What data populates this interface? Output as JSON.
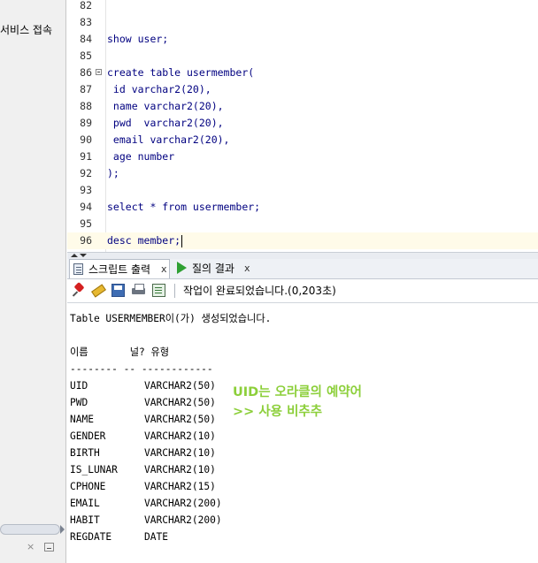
{
  "connections_panel": {
    "label": "서비스 접속"
  },
  "editor": {
    "lines": [
      {
        "num": "82",
        "text": ""
      },
      {
        "num": "83",
        "text": ""
      },
      {
        "num": "84",
        "text": "show user;"
      },
      {
        "num": "85",
        "text": ""
      },
      {
        "num": "86",
        "text": "create table usermember("
      },
      {
        "num": "87",
        "text": " id varchar2(20),"
      },
      {
        "num": "88",
        "text": " name varchar2(20),"
      },
      {
        "num": "89",
        "text": " pwd  varchar2(20),"
      },
      {
        "num": "90",
        "text": " email varchar2(20),"
      },
      {
        "num": "91",
        "text": " age number"
      },
      {
        "num": "92",
        "text": ");"
      },
      {
        "num": "93",
        "text": ""
      },
      {
        "num": "94",
        "text": "select * from usermember;"
      },
      {
        "num": "95",
        "text": ""
      },
      {
        "num": "96",
        "text": "desc member;"
      }
    ],
    "text_color": "#000080",
    "active_line_color": "#fffbe9"
  },
  "tabs": [
    {
      "label": "스크립트 출력",
      "close": "x",
      "icon": "script-output-icon"
    },
    {
      "label": "질의 결과",
      "close": "x",
      "icon": "run-query-icon"
    }
  ],
  "toolbar": {
    "icons": [
      "pin-icon",
      "eraser-icon",
      "save-icon",
      "print-icon",
      "script-icon"
    ],
    "status": "작업이 완료되었습니다.(0,203초)"
  },
  "output": {
    "created_message": "Table USERMEMBER이(가) 생성되었습니다.",
    "header": "이름       널? 유형",
    "separator": "-------- -- ------------",
    "rows": [
      {
        "name": "UID",
        "type": "VARCHAR2(50)"
      },
      {
        "name": "PWD",
        "type": "VARCHAR2(50)"
      },
      {
        "name": "NAME",
        "type": "VARCHAR2(50)"
      },
      {
        "name": "GENDER",
        "type": "VARCHAR2(10)"
      },
      {
        "name": "BIRTH",
        "type": "VARCHAR2(10)"
      },
      {
        "name": "IS_LUNAR",
        "type": "VARCHAR2(10)"
      },
      {
        "name": "CPHONE",
        "type": "VARCHAR2(15)"
      },
      {
        "name": "EMAIL",
        "type": "VARCHAR2(200)"
      },
      {
        "name": "HABIT",
        "type": "VARCHAR2(200)"
      },
      {
        "name": "REGDATE",
        "type": "DATE"
      }
    ],
    "annotation_line1": "UID는 오라클의 예약어",
    "annotation_line2": ">> 사용 비추추",
    "annotation_color": "#8ccf3a"
  },
  "left_bottom": {
    "close": "×"
  }
}
